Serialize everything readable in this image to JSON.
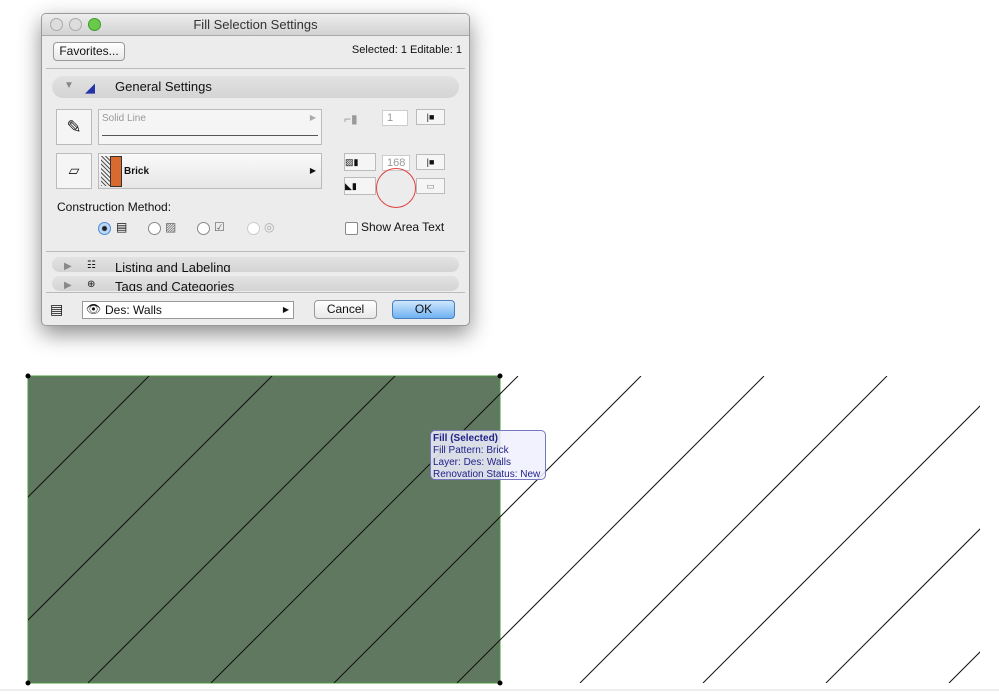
{
  "dialog": {
    "title": "Fill Selection Settings",
    "favorites": "Favorites...",
    "selection_info": "Selected: 1 Editable: 1",
    "general_settings": "General Settings",
    "line_type": "Solid Line",
    "line_pen": "1",
    "fill_type": "Brick",
    "fill_pen": "168",
    "construction_method_label": "Construction Method:",
    "show_area_text": "Show Area Text",
    "show_area_text_checked": false,
    "listing_labeling": "Listing and Labeling",
    "tags_categories": "Tags and Categories",
    "layer": "Des: Walls",
    "cancel": "Cancel",
    "ok": "OK"
  },
  "tooltip": {
    "title": "Fill (Selected)",
    "pattern": "Fill Pattern: Brick",
    "layer": "Layer: Des: Walls",
    "status": "Renovation Status: New"
  },
  "colors": {
    "fill": "#617860",
    "accent": "#5ea8f0",
    "brick": "#d86a30"
  }
}
